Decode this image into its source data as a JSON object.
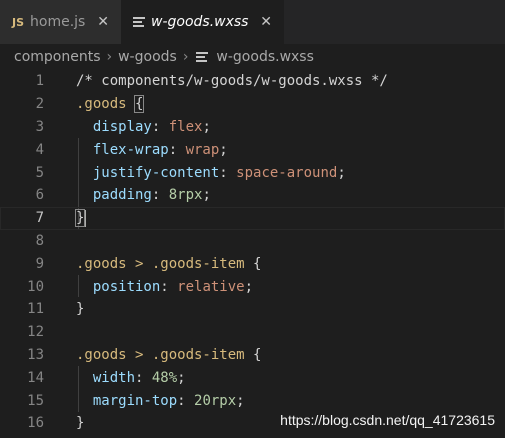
{
  "tabs": [
    {
      "label": "home.js",
      "icon": "JS",
      "active": false,
      "close": "✕"
    },
    {
      "label": "w-goods.wxss",
      "active": true,
      "close": "✕"
    }
  ],
  "breadcrumb": [
    "components",
    "w-goods",
    "w-goods.wxss"
  ],
  "lines": [
    {
      "num": "1",
      "text": "/* components/w-goods/w-goods.wxss */"
    },
    {
      "num": "2",
      "text": ".goods {"
    },
    {
      "num": "3",
      "text": "display: flex;"
    },
    {
      "num": "4",
      "text": "flex-wrap: wrap;"
    },
    {
      "num": "5",
      "text": "justify-content: space-around;"
    },
    {
      "num": "6",
      "text": "padding: 8rpx;"
    },
    {
      "num": "7",
      "text": "}"
    },
    {
      "num": "8",
      "text": ""
    },
    {
      "num": "9",
      "text": ".goods > .goods-item {"
    },
    {
      "num": "10",
      "text": "position: relative;"
    },
    {
      "num": "11",
      "text": "}"
    },
    {
      "num": "12",
      "text": ""
    },
    {
      "num": "13",
      "text": ".goods > .goods-item {"
    },
    {
      "num": "14",
      "text": "width: 48%;"
    },
    {
      "num": "15",
      "text": "margin-top: 20rpx;"
    },
    {
      "num": "16",
      "text": "}"
    }
  ],
  "tokens": {
    "l1": "/* components/w-goods/w-goods.wxss */",
    "l2_sel": ".goods ",
    "l2_brace": "{",
    "l3_p": "display",
    "l3_v": "flex",
    "l4_p": "flex-wrap",
    "l4_v": "wrap",
    "l5_p": "justify-content",
    "l5_v": "space-around",
    "l6_p": "padding",
    "l6_n": "8rpx",
    "l7": "}",
    "l9_sel": ".goods > .goods-item ",
    "l9_brace": "{",
    "l10_p": "position",
    "l10_v": "relative",
    "l11": "}",
    "l13_sel": ".goods > .goods-item ",
    "l13_brace": "{",
    "l14_p": "width",
    "l14_n": "48%",
    "l15_p": "margin-top",
    "l15_n": "20rpx",
    "l16": "}"
  },
  "watermark": "https://blog.csdn.net/qq_41723615"
}
